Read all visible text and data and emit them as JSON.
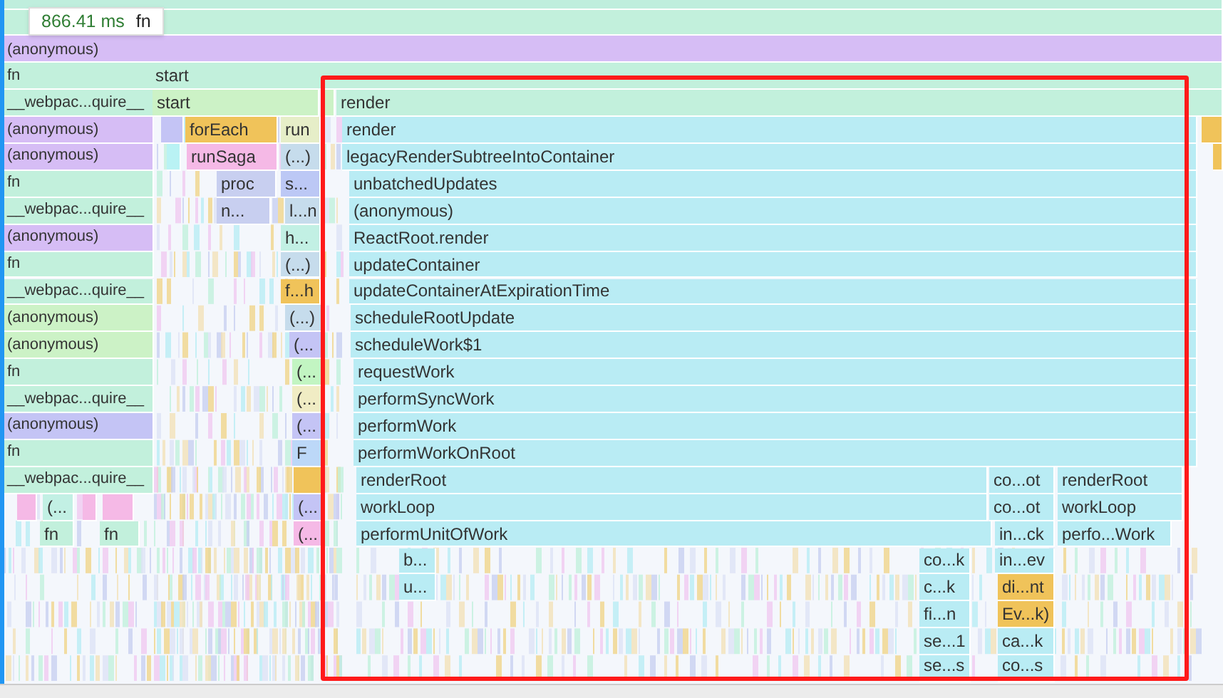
{
  "tooltip": {
    "duration": "866.41 ms",
    "name": "fn"
  },
  "rows": [
    {
      "frames": [
        {
          "color": "#bfeedd"
        }
      ]
    },
    {
      "frames": [
        {
          "color": "#c2f0dc"
        }
      ]
    },
    {
      "frames": [
        {
          "label": "(anonymous)",
          "color": "#d6bdf5"
        }
      ]
    },
    {
      "frames": [
        {
          "label": "fn",
          "color": "#c2f0dc"
        },
        {
          "label": "start",
          "color": "#c2f0dc"
        }
      ]
    },
    {
      "frames": [
        {
          "label": "__webpac...quire__",
          "color": "#c2f0dc"
        },
        {
          "label": "start",
          "color": "#ccf2c6"
        },
        {
          "color": "#ccf2c6"
        },
        {
          "label": "render",
          "color": "#c2f0dc"
        }
      ]
    },
    {
      "frames": [
        {
          "label": "(anonymous)",
          "color": "#d6bdf5"
        },
        {
          "color": "#c4c4f5"
        },
        {
          "label": "forEach",
          "color": "#f0c35a"
        },
        {
          "label": "run",
          "color": "#e6eec8"
        },
        {
          "label": "render",
          "color": "#b9ecf4"
        },
        {
          "color": "#f0c35a"
        }
      ]
    },
    {
      "frames": [
        {
          "label": "(anonymous)",
          "color": "#d6bdf5"
        },
        {
          "color": "#b9f2f4"
        },
        {
          "label": "runSaga",
          "color": "#f5b9e6"
        },
        {
          "label": "(...)",
          "color": "#c6dcec"
        },
        {
          "label": "legacyRenderSubtreeIntoContainer",
          "color": "#b9ecf4"
        },
        {
          "color": "#f0c35a"
        }
      ]
    },
    {
      "frames": [
        {
          "label": "fn",
          "color": "#c2f0dc"
        },
        {
          "label": "proc",
          "color": "#c8cff0"
        },
        {
          "label": "s...",
          "color": "#bcc8f5"
        },
        {
          "label": "unbatchedUpdates",
          "color": "#b9ecf4"
        }
      ]
    },
    {
      "frames": [
        {
          "label": "__webpac...quire__",
          "color": "#c2f0dc"
        },
        {
          "label": "n...",
          "color": "#c8cff0"
        },
        {
          "label": "l...n",
          "color": "#c6dcec"
        },
        {
          "label": "(anonymous)",
          "color": "#b9ecf4"
        }
      ]
    },
    {
      "frames": [
        {
          "label": "(anonymous)",
          "color": "#d6bdf5"
        },
        {
          "label": "h...",
          "color": "#c2f0e4"
        },
        {
          "label": "ReactRoot.render",
          "color": "#b9ecf4"
        }
      ]
    },
    {
      "frames": [
        {
          "label": "fn",
          "color": "#c2f0dc"
        },
        {
          "label": "(...)",
          "color": "#c6dcec"
        },
        {
          "label": "updateContainer",
          "color": "#b9ecf4"
        }
      ]
    },
    {
      "frames": [
        {
          "label": "__webpac...quire__",
          "color": "#c2f0dc"
        },
        {
          "label": "f...h",
          "color": "#f0c35a"
        },
        {
          "label": "updateContainerAtExpirationTime",
          "color": "#b9ecf4"
        }
      ]
    },
    {
      "frames": [
        {
          "label": "(anonymous)",
          "color": "#ccf2c6"
        },
        {
          "label": "(...)",
          "color": "#c6dcec"
        },
        {
          "label": "scheduleRootUpdate",
          "color": "#b9ecf4"
        }
      ]
    },
    {
      "frames": [
        {
          "label": "(anonymous)",
          "color": "#ccf2c6"
        },
        {
          "label": "(...",
          "color": "#c4c4f5"
        },
        {
          "label": "scheduleWork$1",
          "color": "#b9ecf4"
        }
      ]
    },
    {
      "frames": [
        {
          "label": "fn",
          "color": "#c2f0dc"
        },
        {
          "label": "(...",
          "color": "#c2f5c2"
        },
        {
          "label": "requestWork",
          "color": "#b9ecf4"
        }
      ]
    },
    {
      "frames": [
        {
          "label": "__webpac...quire__",
          "color": "#c2f0dc"
        },
        {
          "label": "(...",
          "color": "#f0ecc4"
        },
        {
          "label": "performSyncWork",
          "color": "#b9ecf4"
        }
      ]
    },
    {
      "frames": [
        {
          "label": "(anonymous)",
          "color": "#c4c4f5"
        },
        {
          "label": "(...",
          "color": "#c4c4f5"
        },
        {
          "label": "performWork",
          "color": "#b9ecf4"
        }
      ]
    },
    {
      "frames": [
        {
          "label": "fn",
          "color": "#c2f0dc"
        },
        {
          "label": "F",
          "color": "#bcd8f8"
        },
        {
          "label": "performWorkOnRoot",
          "color": "#b9ecf4"
        }
      ]
    },
    {
      "frames": [
        {
          "label": "__webpac...quire__",
          "color": "#c2f0dc"
        },
        {
          "color": "#f0c35a"
        },
        {
          "label": "renderRoot",
          "color": "#b9ecf4"
        },
        {
          "label": "co...ot",
          "color": "#b9ecf4"
        },
        {
          "label": "renderRoot",
          "color": "#b9ecf4"
        }
      ]
    },
    {
      "frames": [
        {
          "color": "#f5b9e6"
        },
        {
          "label": "(...",
          "color": "#c2f0e4"
        },
        {
          "color": "#f5b9e6"
        },
        {
          "color": "#f5b9e6"
        },
        {
          "label": "(...",
          "color": "#c4c4f5"
        },
        {
          "label": "workLoop",
          "color": "#b9ecf4"
        },
        {
          "label": "co...ot",
          "color": "#b9ecf4"
        },
        {
          "label": "workLoop",
          "color": "#b9ecf4"
        }
      ]
    },
    {
      "frames": [
        {
          "label": "fn",
          "color": "#c2f0dc"
        },
        {
          "label": "fn",
          "color": "#c2f0dc"
        },
        {
          "label": "(...",
          "color": "#f5b9e6"
        },
        {
          "label": "performUnitOfWork",
          "color": "#b9ecf4"
        },
        {
          "label": "in...ck",
          "color": "#b9ecf4"
        },
        {
          "label": "perfo...Work",
          "color": "#b9ecf4"
        }
      ]
    },
    {
      "frames": [
        {
          "label": "b...",
          "color": "#b9ecf4"
        },
        {
          "label": "co...k",
          "color": "#b9ecf4"
        },
        {
          "label": "in...ev",
          "color": "#b9ecf4"
        }
      ]
    },
    {
      "frames": [
        {
          "label": "u...",
          "color": "#b9ecf4"
        },
        {
          "label": "c...k",
          "color": "#b9ecf4"
        },
        {
          "label": "di...nt",
          "color": "#f0c35a"
        }
      ]
    },
    {
      "frames": [
        {
          "label": "fi...n",
          "color": "#b9ecf4"
        },
        {
          "label": "Ev...k)",
          "color": "#f0c35a"
        }
      ]
    },
    {
      "frames": [
        {
          "label": "se...1",
          "color": "#b9ecf4"
        },
        {
          "label": "ca...k",
          "color": "#b9ecf4"
        }
      ]
    },
    {
      "frames": [
        {
          "label": "se...s",
          "color": "#b9ecf4"
        },
        {
          "label": "co...s",
          "color": "#b9ecf4"
        }
      ]
    }
  ]
}
